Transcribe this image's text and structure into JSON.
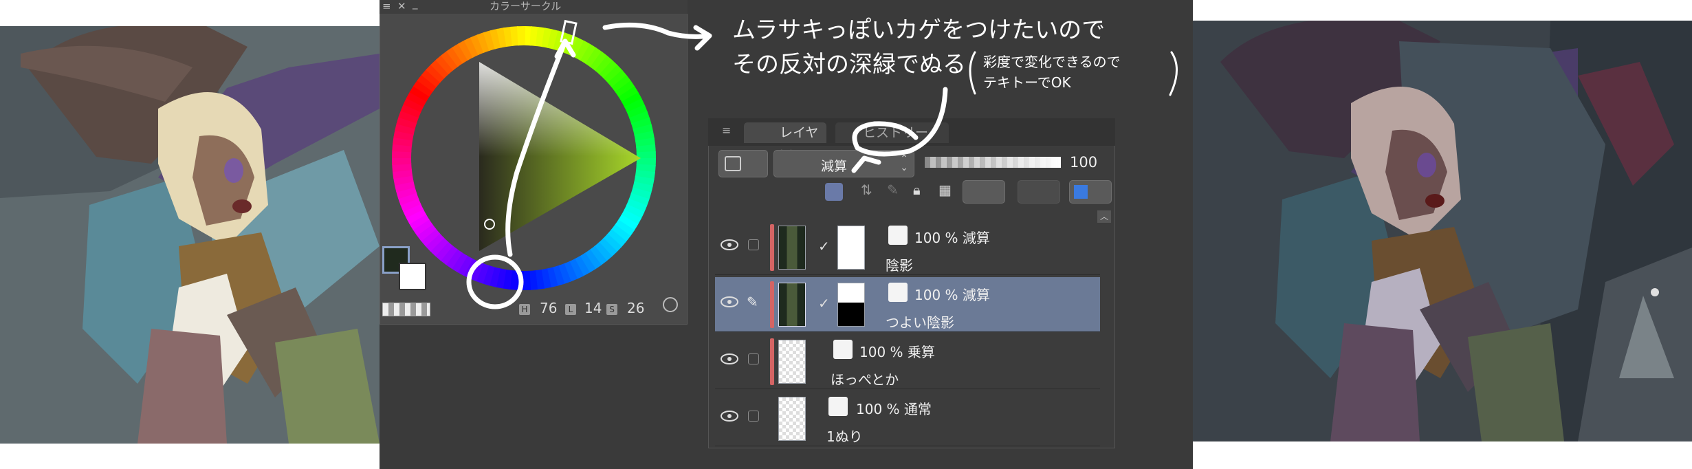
{
  "color_circle_panel": {
    "title": "カラーサークル",
    "h_label": "H",
    "h_value": "76",
    "l_label": "L",
    "l_value": "14",
    "s_label": "S",
    "s_value": "26"
  },
  "annotation": {
    "line1": "ムラサキっぽいカゲをつけたいので",
    "line2": "その反対の深緑でぬる",
    "line3": "彩度で変化できるので",
    "line4": "テキトーでOK"
  },
  "layer_panel": {
    "tabs": [
      "レイヤー",
      "ヒストリー"
    ],
    "blend_mode": "減算",
    "opacity": "100",
    "layers": [
      {
        "opacity_mode": "100 % 減算",
        "name": "陰影",
        "selected": false
      },
      {
        "opacity_mode": "100 % 減算",
        "name": "つよい陰影",
        "selected": true
      },
      {
        "opacity_mode": "100 % 乗算",
        "name": "ほっぺとか",
        "selected": false
      },
      {
        "opacity_mode": "100 % 通常",
        "name": "1ぬり",
        "selected": false
      }
    ]
  },
  "colors": {
    "app_bg": "#3a3a3a",
    "panel_bg": "#4a4a4a",
    "selected_row": "#6b7a96",
    "red_marker": "#d46464"
  }
}
